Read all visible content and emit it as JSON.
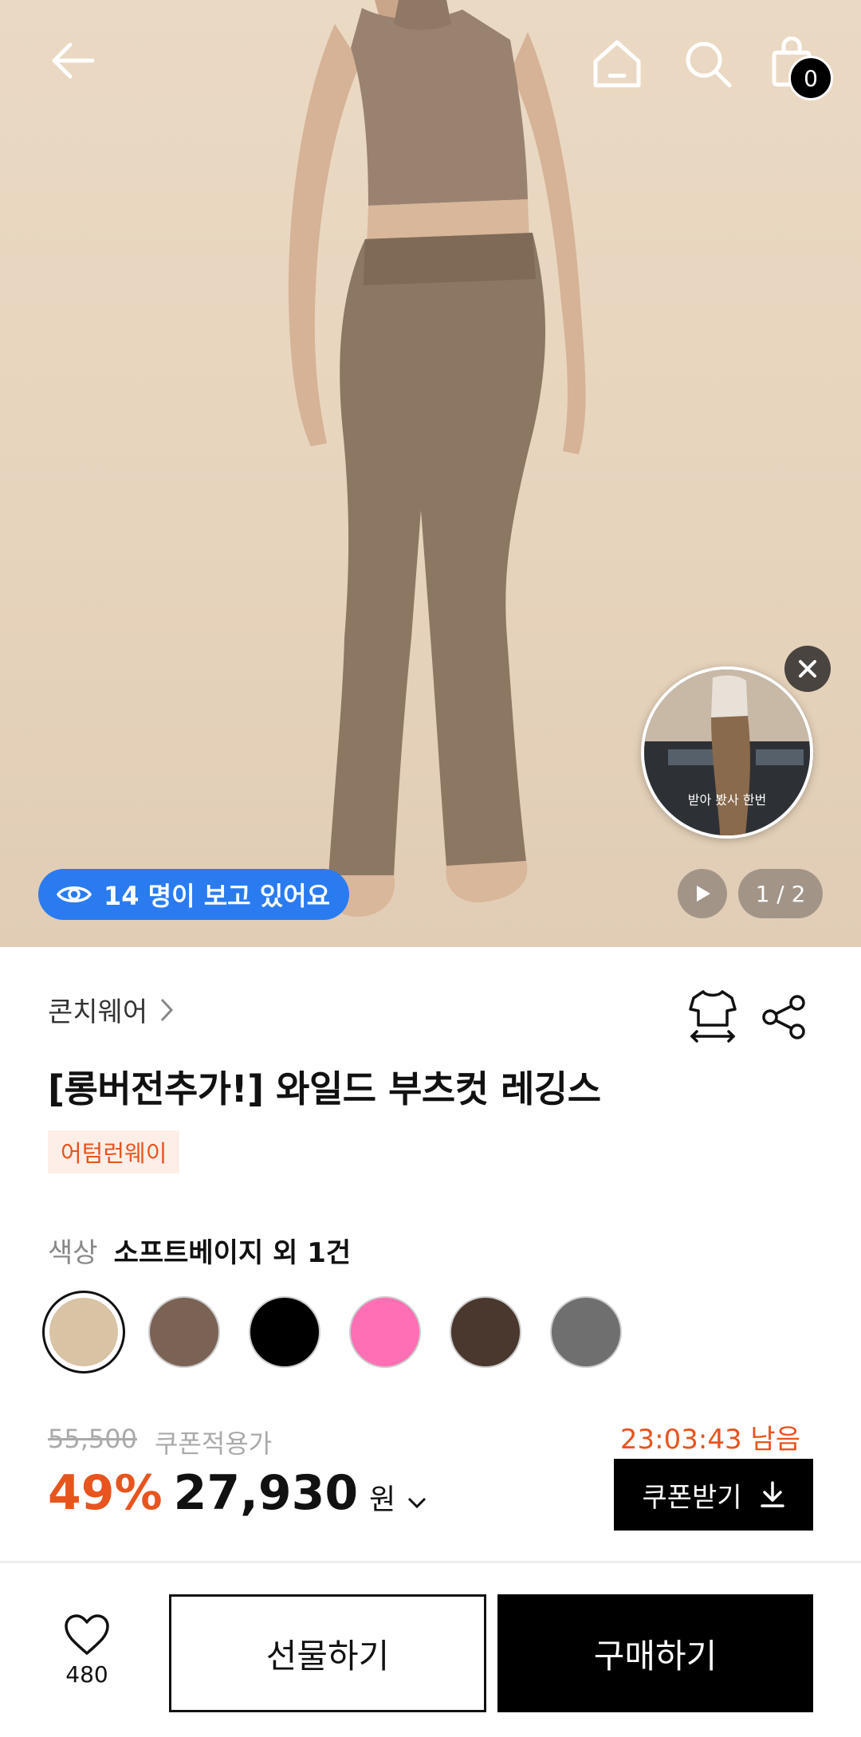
{
  "header": {
    "cart_count": "0",
    "icons": [
      "back-arrow-icon",
      "home-icon",
      "search-icon",
      "shopping-bag-icon"
    ]
  },
  "hero": {
    "viewers_text": "14 명이 보고 있어요",
    "video_caption": "받아 봤사 한번",
    "page_indicator": "1 / 2"
  },
  "product": {
    "brand": "콘치웨어",
    "title": "[롱버전추가!] 와일드 부츠컷 레깅스",
    "tag": "어텀런웨이",
    "color_label": "색상",
    "color_value": "소프트베이지 외 1건",
    "swatches": [
      "#d9c3a5",
      "#7a6255",
      "#000000",
      "#ff6fb5",
      "#4a372d",
      "#6f6f6f"
    ]
  },
  "pricing": {
    "original_price": "55,500",
    "coupon_label": "쿠폰적용가",
    "timer": "23:03:43 남음",
    "discount": "49%",
    "price": "27,930",
    "currency": "원",
    "coupon_button": "쿠폰받기",
    "accent_color": "#e8541e"
  },
  "bottom_bar": {
    "like_count": "480",
    "gift_label": "선물하기",
    "buy_label": "구매하기"
  }
}
